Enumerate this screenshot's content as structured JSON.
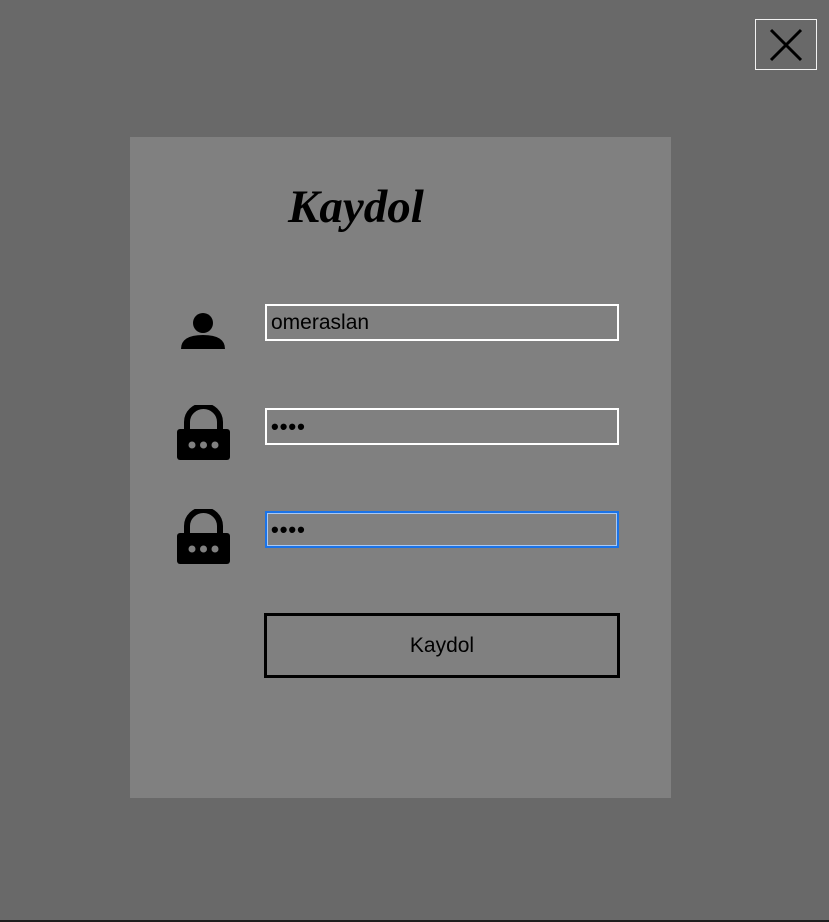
{
  "window": {
    "close_icon": "close-icon"
  },
  "form": {
    "title": "Kaydol",
    "username": {
      "icon": "user-icon",
      "value": "omeraslan"
    },
    "password": {
      "icon": "lock-icon",
      "value": "1234"
    },
    "password_confirm": {
      "icon": "lock-icon",
      "value": "1234",
      "focused": true
    },
    "submit_label": "Kaydol"
  },
  "colors": {
    "background": "#696969",
    "panel": "#808080",
    "focus_border": "#1a73e8"
  }
}
